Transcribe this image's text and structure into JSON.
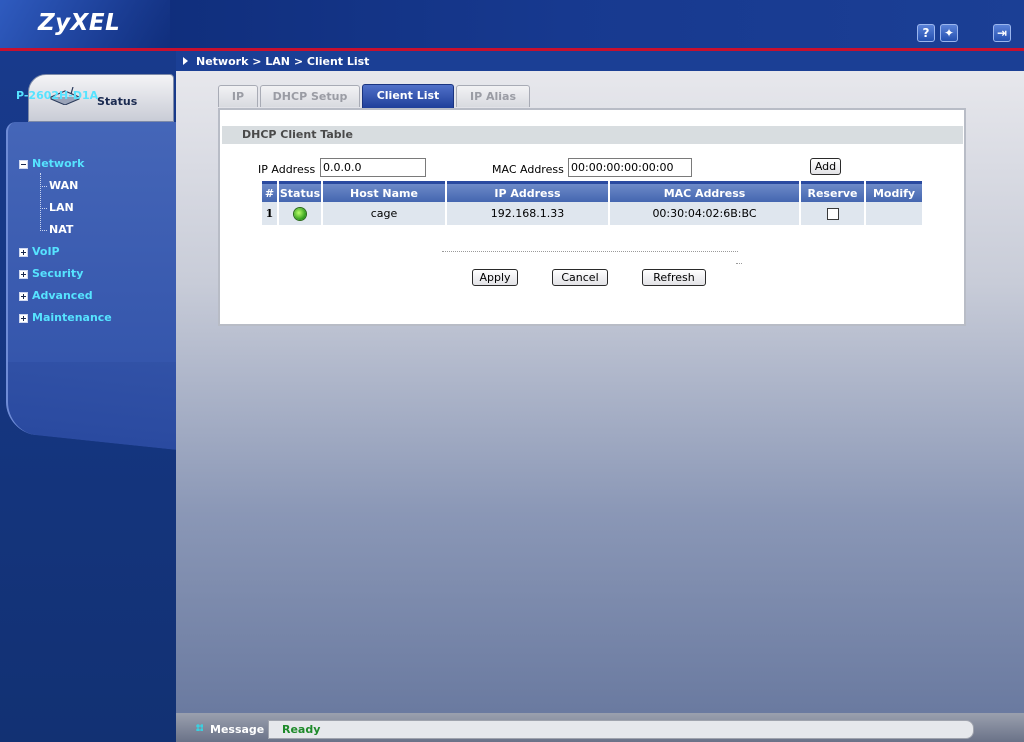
{
  "brand": {
    "logo_text": "ZyXEL"
  },
  "header": {
    "icons": [
      {
        "name": "help-icon",
        "glyph": "?"
      },
      {
        "name": "wizard-icon",
        "glyph": "✦"
      },
      {
        "name": "logout-icon",
        "glyph": "⇥"
      }
    ]
  },
  "sidebar": {
    "status_label": "Status",
    "model": "P-2602H-D1A",
    "items": [
      {
        "label": "Network",
        "expanded": true,
        "children": [
          "WAN",
          "LAN",
          "NAT"
        ]
      },
      {
        "label": "VoIP",
        "expanded": false
      },
      {
        "label": "Security",
        "expanded": false
      },
      {
        "label": "Advanced",
        "expanded": false
      },
      {
        "label": "Maintenance",
        "expanded": false
      }
    ]
  },
  "breadcrumb": "Network > LAN > Client List",
  "tabs": [
    {
      "label": "IP",
      "active": false
    },
    {
      "label": "DHCP Setup",
      "active": false
    },
    {
      "label": "Client List",
      "active": true
    },
    {
      "label": "IP Alias",
      "active": false
    }
  ],
  "section_title": "DHCP Client Table",
  "form": {
    "ip_label": "IP Address",
    "ip_value": "0.0.0.0",
    "mac_label": "MAC Address",
    "mac_value": "00:00:00:00:00:00",
    "add_label": "Add"
  },
  "table": {
    "headers": [
      "#",
      "Status",
      "Host Name",
      "IP Address",
      "MAC Address",
      "Reserve",
      "Modify"
    ],
    "rows": [
      {
        "index": "1",
        "status": "online",
        "host": "cage",
        "ip": "192.168.1.33",
        "mac": "00:30:04:02:6B:BC",
        "reserve": false,
        "modify": ""
      }
    ]
  },
  "buttons": {
    "apply": "Apply",
    "cancel": "Cancel",
    "refresh": "Refresh"
  },
  "message": {
    "label": "Message",
    "text": "Ready"
  },
  "colors": {
    "accent": "#1b3f95",
    "highlight": "#56e3ff",
    "header_rule": "#c8102e",
    "ready_text": "#1e8a2a"
  }
}
